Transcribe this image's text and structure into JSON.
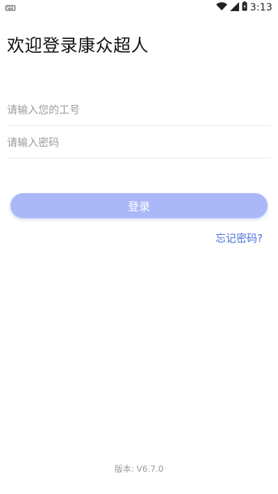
{
  "status_bar": {
    "time": "3:13",
    "icons": [
      "keyboard-icon",
      "wifi-icon",
      "signal-icon",
      "battery-icon"
    ]
  },
  "login": {
    "title": "欢迎登录康众超人",
    "employee_id_placeholder": "请输入您的工号",
    "password_placeholder": "请输入密码",
    "login_label": "登录",
    "forgot_password_label": "忘记密码?"
  },
  "footer": {
    "version": "版本: V6.7.0"
  },
  "colors": {
    "accent": "#aab8f8",
    "link": "#4a6fd8"
  }
}
